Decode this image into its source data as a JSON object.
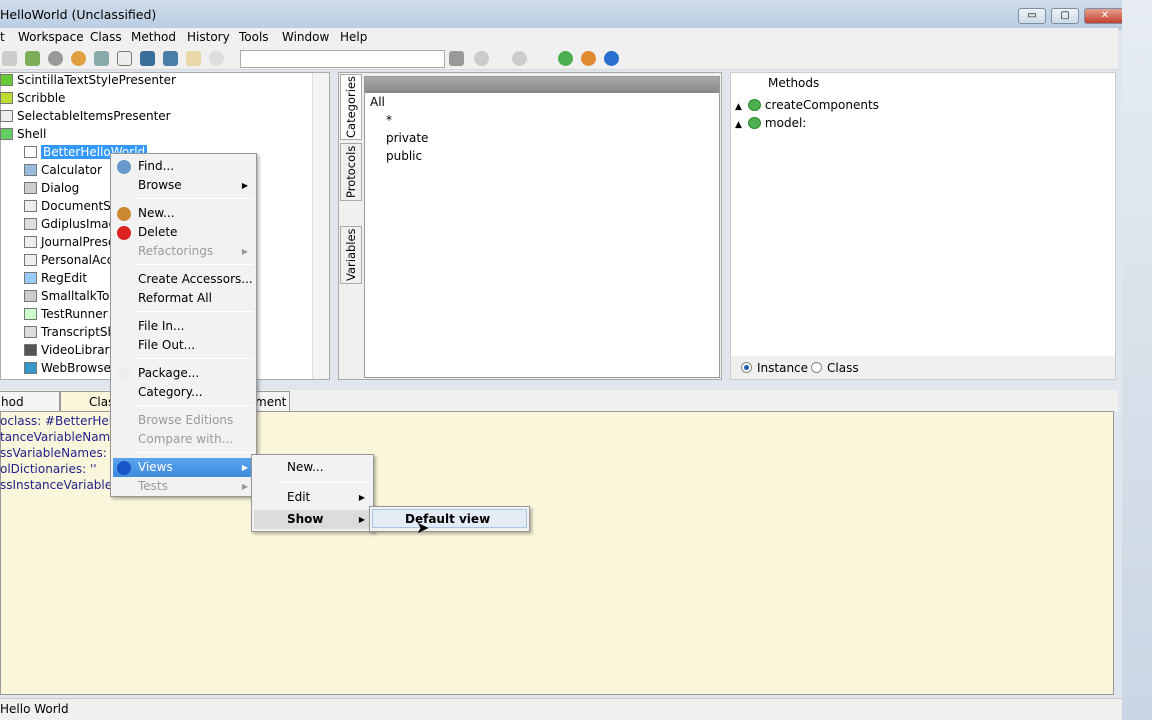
{
  "window": {
    "title": "HelloWorld (Unclassified)",
    "minimize": "▭",
    "maximize": "▢",
    "close": "✕"
  },
  "menubar": [
    "t",
    "Workspace",
    "Class",
    "Method",
    "History",
    "Tools",
    "Window",
    "Help"
  ],
  "tree": {
    "items": [
      "ScintillaTextStylePresenter",
      "Scribble",
      "SelectableItemsPresenter",
      "Shell",
      "BetterHelloWorld",
      "Calculator",
      "Dialog",
      "DocumentShell",
      "GdiplusImageView",
      "JournalPresenter",
      "PersonalAccountShell",
      "RegEdit",
      "SmalltalkToolShell",
      "TestRunner",
      "TranscriptShell",
      "VideoLibraryShell",
      "WebBrowserShell"
    ]
  },
  "middle": {
    "tabs": [
      "Categories",
      "Protocols",
      "Variables"
    ],
    "categories": [
      "All",
      "*",
      "private",
      "public"
    ]
  },
  "methods": {
    "header": "Methods",
    "items": [
      "createComponents",
      "model:"
    ],
    "radio": {
      "instance": "Instance",
      "class": "Class",
      "selected": "Instance"
    }
  },
  "bottom_tabs": [
    "hod source",
    "Class",
    "ment"
  ],
  "source": [
    "oclass: #BetterHelloWorld",
    "tanceVariableNames: 'textPresenter'",
    "ssVariableNames: ''",
    "olDictionaries: ''",
    "ssInstanceVariableNames: ''"
  ],
  "context_menu": {
    "items": [
      "Find...",
      "Browse",
      "New...",
      "Delete",
      "Refactorings",
      "Create Accessors...",
      "Reformat All",
      "File In...",
      "File Out...",
      "Package...",
      "Category...",
      "Browse Editions",
      "Compare with...",
      "Views",
      "Tests"
    ]
  },
  "views_submenu": {
    "items": [
      "New...",
      "Edit",
      "Show"
    ]
  },
  "show_submenu": {
    "items": [
      "Default view"
    ]
  },
  "status": "Hello World"
}
